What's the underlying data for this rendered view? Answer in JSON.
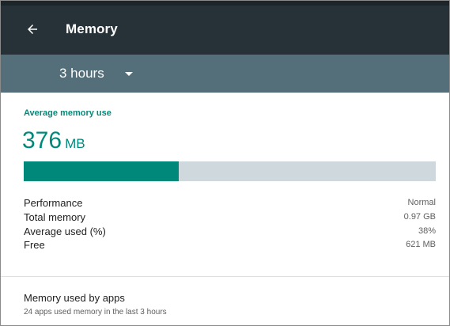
{
  "header": {
    "title": "Memory",
    "back_icon": "arrow-back-icon"
  },
  "period": {
    "selected": "3 hours",
    "dropdown_icon": "caret-down-icon"
  },
  "average": {
    "section_title": "Average memory use",
    "value": "376",
    "unit": "MB",
    "usage_fraction": 0.376
  },
  "stats": [
    {
      "label": "Performance",
      "value": "Normal"
    },
    {
      "label": "Total memory",
      "value": "0.97 GB"
    },
    {
      "label": "Average used (%)",
      "value": "38%"
    },
    {
      "label": "Free",
      "value": "621 MB"
    }
  ],
  "apps": {
    "title": "Memory used by apps",
    "subtitle": "24 apps used memory in the last 3 hours"
  },
  "colors": {
    "accent": "#00897b",
    "appbar": "#263238",
    "subbar": "#546e7a",
    "track": "#cfd8dc"
  }
}
